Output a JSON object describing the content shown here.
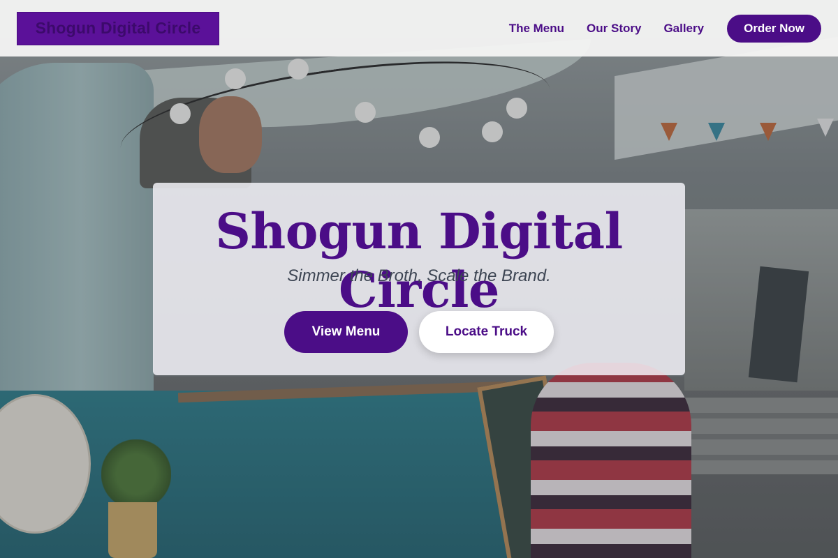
{
  "brand": {
    "name": "Shogun Digital Circle"
  },
  "nav": {
    "items": [
      {
        "label": "The Menu"
      },
      {
        "label": "Our Story"
      },
      {
        "label": "Gallery"
      }
    ],
    "cta_label": "Order Now"
  },
  "hero": {
    "title": "Shogun Digital Circle",
    "tagline": "Simmer the Broth, Scale the Brand.",
    "primary_button": "View Menu",
    "secondary_button": "Locate Truck"
  },
  "colors": {
    "brand_purple": "#4b0d87",
    "header_bg": "#f5f5f4",
    "tagline_text": "#3d4553"
  }
}
